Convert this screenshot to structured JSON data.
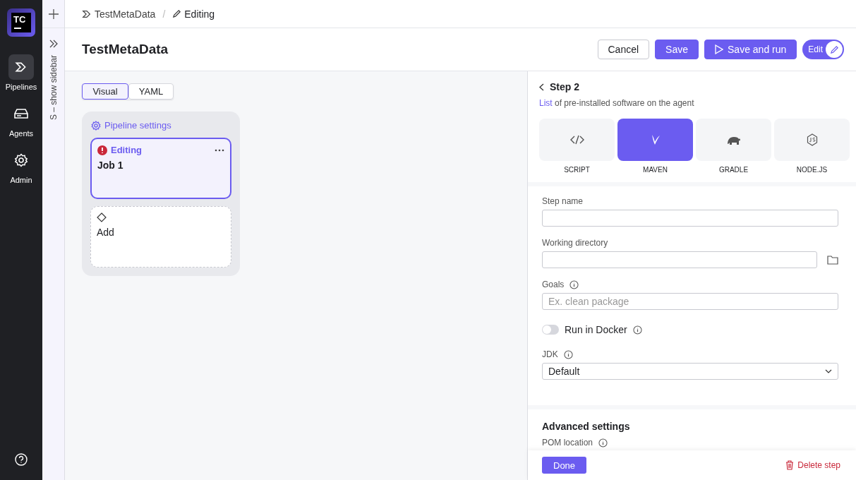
{
  "logo": {
    "text": "TC"
  },
  "nav": [
    {
      "label": "Pipelines",
      "selected": true,
      "kind": "pipelines"
    },
    {
      "label": "Agents",
      "selected": false,
      "kind": "agents"
    },
    {
      "label": "Admin",
      "selected": false,
      "kind": "admin"
    }
  ],
  "sidebar_toggle": {
    "label": "S – show sidebar"
  },
  "breadcrumb_separator": "/",
  "breadcrumbs": [
    {
      "label": "TestMetaData",
      "kind": "pipeline"
    },
    {
      "label": "Editing",
      "kind": "edit"
    }
  ],
  "title": "TestMetaData",
  "actions": [
    {
      "label": "Cancel",
      "kind": "secondary"
    },
    {
      "label": "Save",
      "kind": "primary"
    },
    {
      "label": "Save and run",
      "kind": "run"
    },
    {
      "label": "Edit",
      "kind": "toggle",
      "on": true
    }
  ],
  "view_tabs": [
    {
      "label": "Visual",
      "selected": true
    },
    {
      "label": "YAML",
      "selected": false
    }
  ],
  "pipeline": {
    "settings_label": "Pipeline settings",
    "jobs": [
      {
        "status": "Editing",
        "name": "Job 1",
        "selected": true,
        "error": true
      }
    ],
    "add_label": "Add"
  },
  "step_panel": {
    "title": "Step 2",
    "link": "List",
    "description": "of pre-installed software on the agent",
    "runners": [
      {
        "label": "SCRIPT",
        "kind": "script",
        "selected": false
      },
      {
        "label": "MAVEN",
        "kind": "maven",
        "selected": true
      },
      {
        "label": "GRADLE",
        "kind": "gradle",
        "selected": false
      },
      {
        "label": "NODE.JS",
        "kind": "nodejs",
        "selected": false
      }
    ],
    "fields": [
      {
        "kind": "text",
        "label": "Step name",
        "info": false
      },
      {
        "kind": "browse",
        "label": "Working directory",
        "info": false
      },
      {
        "kind": "text",
        "label": "Goals",
        "info": true,
        "placeholder": "Ex. clean package"
      },
      {
        "kind": "toggle",
        "label": "Run in Docker",
        "info": true,
        "on": false
      },
      {
        "kind": "select",
        "label": "JDK",
        "info": true,
        "value": "Default"
      }
    ],
    "advanced": {
      "title": "Advanced settings",
      "fields": [
        {
          "label": "POM location",
          "info": true
        }
      ]
    },
    "done_label": "Done",
    "delete_label": "Delete step"
  }
}
